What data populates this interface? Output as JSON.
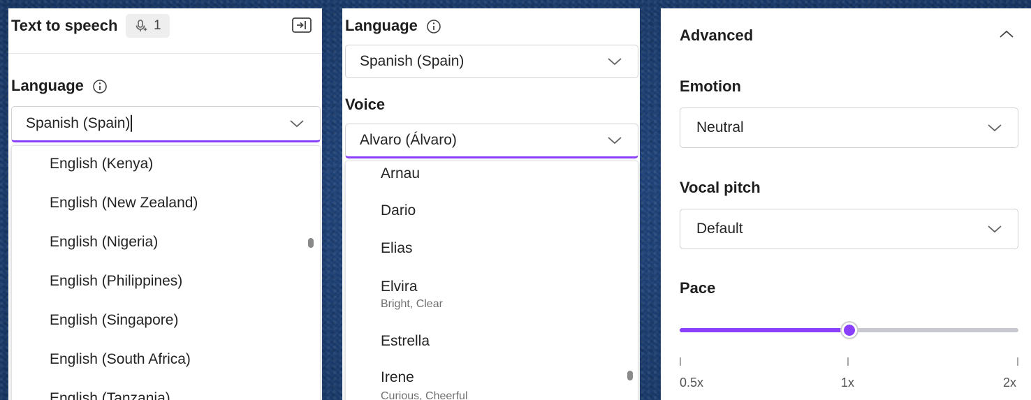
{
  "panel1": {
    "title": "Text to speech",
    "voice_count": "1",
    "language_label": "Language",
    "language_value": "Spanish (Spain)",
    "options": [
      "English (Kenya)",
      "English (New Zealand)",
      "English (Nigeria)",
      "English (Philippines)",
      "English (Singapore)",
      "English (South Africa)",
      "English (Tanzania)"
    ]
  },
  "panel2": {
    "language_label": "Language",
    "language_value": "Spanish (Spain)",
    "voice_label": "Voice",
    "voice_value": "Alvaro (Álvaro)",
    "voices": [
      {
        "name": "Arnau",
        "desc": ""
      },
      {
        "name": "Dario",
        "desc": ""
      },
      {
        "name": "Elias",
        "desc": ""
      },
      {
        "name": "Elvira",
        "desc": "Bright, Clear"
      },
      {
        "name": "Estrella",
        "desc": ""
      },
      {
        "name": "Irene",
        "desc": "Curious, Cheerful"
      }
    ]
  },
  "panel3": {
    "section_title": "Advanced",
    "emotion_label": "Emotion",
    "emotion_value": "Neutral",
    "pitch_label": "Vocal pitch",
    "pitch_value": "Default",
    "pace_label": "Pace",
    "pace": {
      "min_label": "0.5x",
      "mid_label": "1x",
      "max_label": "2x",
      "value_fraction": 0.5
    }
  },
  "colors": {
    "accent": "#8a3ffc",
    "track": "#c8c8d0"
  },
  "icons": {
    "voice_badge": "mic-sparkle-icon",
    "panel_toggle": "panel-collapse-icon",
    "info": "info-icon",
    "dropdown": "chevron-down-icon",
    "collapse": "chevron-up-icon"
  }
}
